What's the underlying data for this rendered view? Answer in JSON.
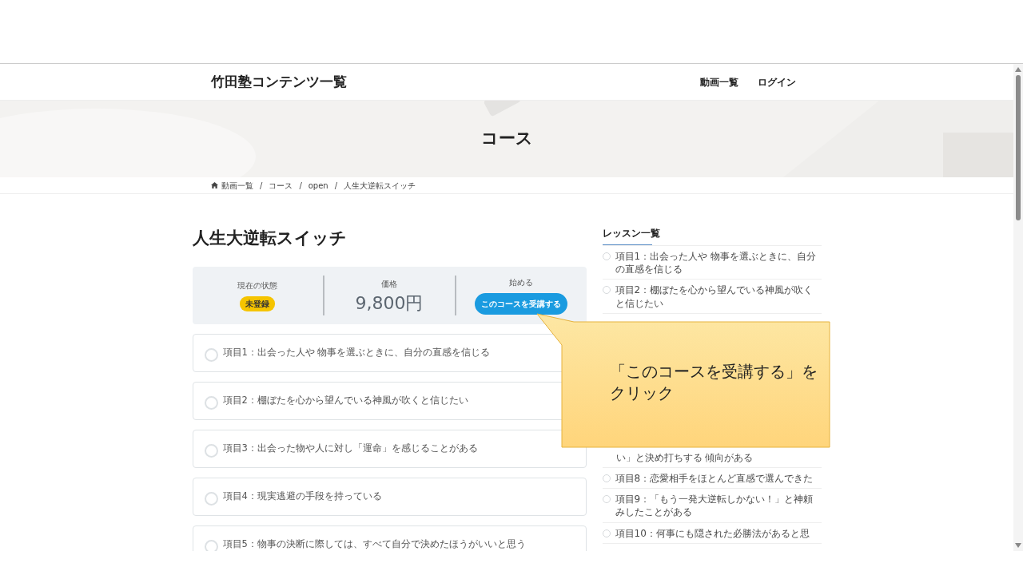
{
  "header": {
    "logo": "竹田塾コンテンツ一覧",
    "nav": [
      "動画一覧",
      "ログイン"
    ]
  },
  "hero": {
    "kind": "picture",
    "title": "コース"
  },
  "breadcrumb": {
    "separator": "/",
    "items": [
      "動画一覧",
      "コース",
      "open",
      "人生大逆転スイッチ"
    ]
  },
  "course": {
    "title": "人生大逆転スイッチ",
    "status": {
      "label": "現在の状態",
      "badge": "未登録"
    },
    "price": {
      "label": "価格",
      "value": "9,800円"
    },
    "start": {
      "label": "始める",
      "button": "このコースを受講する"
    }
  },
  "lessons": [
    {
      "title": "項目1：出会った人や 物事を選ぶときに、自分の直感を信じる",
      "completed": false
    },
    {
      "title": "項目2：棚ぼたを心から望んでいる神風が吹くと信じたい",
      "completed": false
    },
    {
      "title": "項目3：出会った物や人に対し「運命」を感じることがある",
      "completed": false
    },
    {
      "title": "項目4：現実逃避の手段を持っている",
      "completed": false
    },
    {
      "title": "項目5：物事の決断に際しては、すべて自分で決めたほうがいいと思う",
      "completed": false
    }
  ],
  "sidebar": {
    "title": "レッスン一覧",
    "items": [
      {
        "kind": "lesson",
        "text": "項目1：出会った人や 物事を選ぶときに、自分の直感を信じる",
        "completed": false
      },
      {
        "kind": "lesson",
        "text": "項目2：棚ぼたを心から望んでいる神風が吹くと信じたい",
        "completed": false
      },
      {
        "kind": "continuation",
        "text": "い」と決め打ちする 傾向がある"
      },
      {
        "kind": "lesson",
        "text": "項目8：恋愛相手をほとんど直感で選んできた",
        "completed": false
      },
      {
        "kind": "lesson",
        "text": "項目9：「もう一発大逆転しかない！」と神頼みしたことがある",
        "completed": false
      },
      {
        "kind": "lesson",
        "text": "項目10：何事にも隠された必勝法があると思",
        "completed": false
      }
    ]
  },
  "callout": {
    "lines": [
      "「このコースを受講する」を",
      "クリック"
    ]
  }
}
